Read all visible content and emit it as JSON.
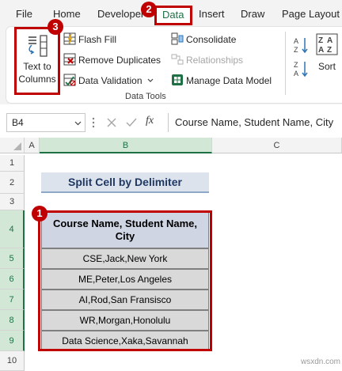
{
  "menu": {
    "file": "File",
    "home": "Home",
    "developer": "Developer",
    "data": "Data",
    "insert": "Insert",
    "draw": "Draw",
    "page_layout": "Page Layout"
  },
  "ribbon": {
    "text_to_columns_line1": "Text to",
    "text_to_columns_line2": "Columns",
    "flash_fill": "Flash Fill",
    "remove_duplicates": "Remove Duplicates",
    "data_validation": "Data Validation",
    "consolidate": "Consolidate",
    "relationships": "Relationships",
    "manage_data_model": "Manage Data Model",
    "sort": "Sort",
    "group_label": "Data Tools"
  },
  "badges": {
    "one": "1",
    "two": "2",
    "three": "3"
  },
  "formula_bar": {
    "name_box": "B4",
    "fx": "fx",
    "formula": "Course Name, Student Name, City"
  },
  "sheet": {
    "columns": [
      "A",
      "B",
      "C"
    ],
    "rows": [
      "1",
      "2",
      "3",
      "4",
      "5",
      "6",
      "7",
      "8",
      "9",
      "10"
    ],
    "title": "Split Cell by Delimiter",
    "header_line1": "Course Name, Student Name,",
    "header_line2": "City",
    "data": [
      "CSE,Jack,New York",
      "ME,Peter,Los Angeles",
      "AI,Rod,San Fransisco",
      "WR,Morgan,Honolulu",
      "Data Science,Xaka,Savannah"
    ]
  },
  "colors": {
    "accent_red": "#c00000",
    "excel_green": "#1e7145",
    "title_text": "#1f3864",
    "header_fill": "#cfd5e3",
    "data_fill": "#d9d9d9"
  },
  "watermark": "wsxdn.com"
}
